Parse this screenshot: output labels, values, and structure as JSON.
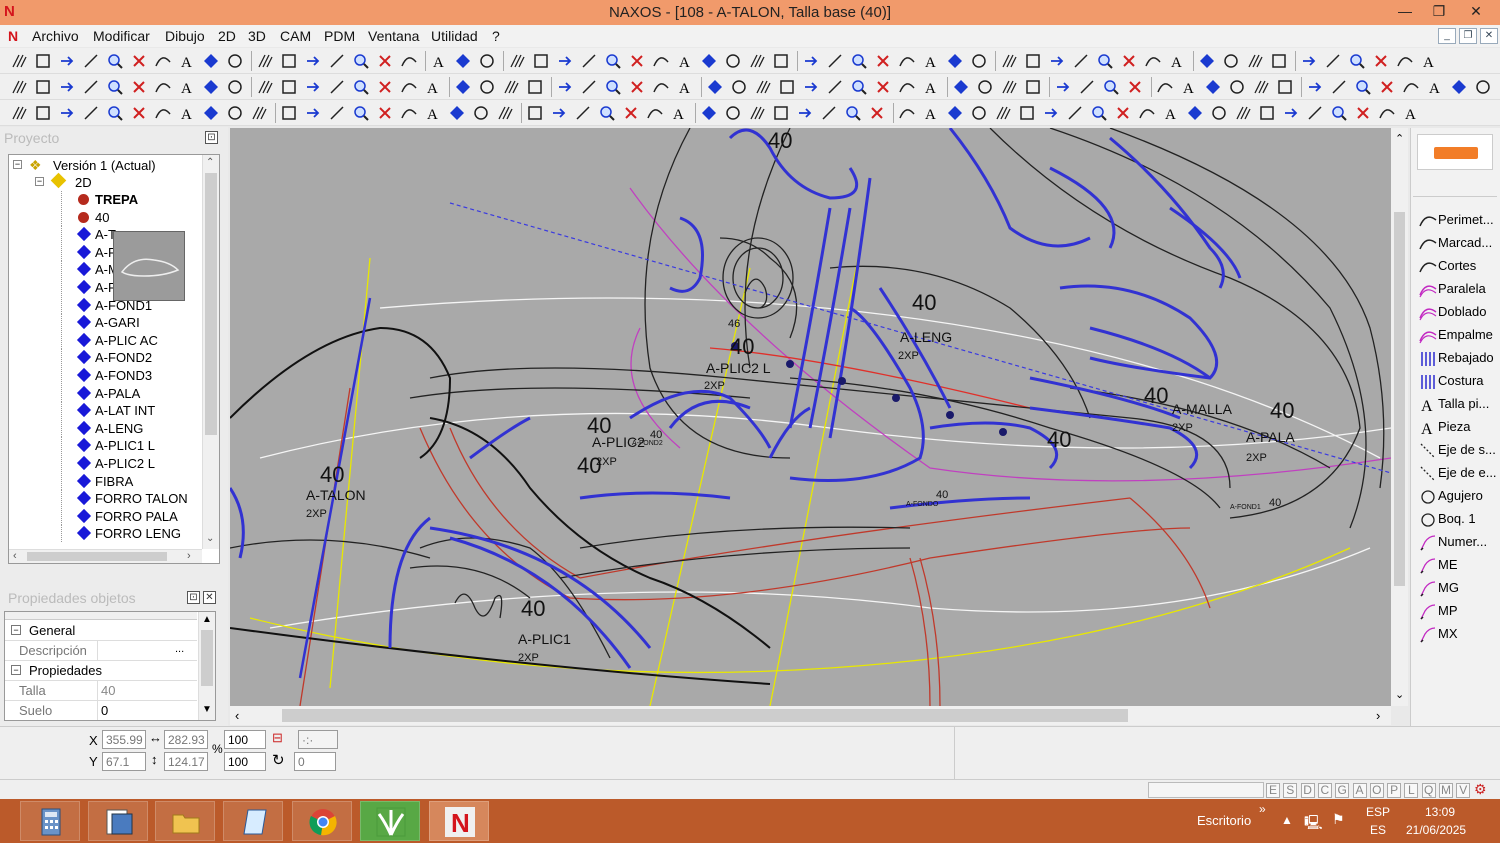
{
  "window": {
    "title": "NAXOS - [108 - A-TALON, Talla base (40)]",
    "minimize": "—",
    "maximize": "❐",
    "close": "✕"
  },
  "menu": [
    "Archivo",
    "Modificar",
    "Dibujo",
    "2D",
    "3D",
    "CAM",
    "PDM",
    "Ventana",
    "Utilidad",
    "?"
  ],
  "project_panel": {
    "title": "Proyecto",
    "root": "Versión 1 (Actual)",
    "folder": "2D",
    "items": [
      {
        "label": "TREPA",
        "type": "dot",
        "bold": true
      },
      {
        "label": "40",
        "type": "dot"
      },
      {
        "label": "A-T",
        "type": "dia"
      },
      {
        "label": "A-F",
        "type": "dia"
      },
      {
        "label": "A-M",
        "type": "dia"
      },
      {
        "label": "A-F",
        "type": "dia"
      },
      {
        "label": "A-FOND1",
        "type": "dia"
      },
      {
        "label": "A-GARI",
        "type": "dia"
      },
      {
        "label": "A-PLIC AC",
        "type": "dia"
      },
      {
        "label": "A-FOND2",
        "type": "dia"
      },
      {
        "label": "A-FOND3",
        "type": "dia"
      },
      {
        "label": "A-PALA",
        "type": "dia"
      },
      {
        "label": "A-LAT INT",
        "type": "dia"
      },
      {
        "label": "A-LENG",
        "type": "dia"
      },
      {
        "label": "A-PLIC1 L",
        "type": "dia"
      },
      {
        "label": "A-PLIC2 L",
        "type": "dia"
      },
      {
        "label": "FIBRA",
        "type": "dia"
      },
      {
        "label": "FORRO TALON",
        "type": "dia"
      },
      {
        "label": "FORRO PALA",
        "type": "dia"
      },
      {
        "label": "FORRO LENG",
        "type": "dia"
      }
    ]
  },
  "properties_panel": {
    "title": "Propiedades objetos",
    "general": "General",
    "descripcion_label": "Descripción",
    "descripcion_btn": "...",
    "propiedades": "Propiedades",
    "talla_label": "Talla",
    "talla_value": "40",
    "suelo_label": "Suelo",
    "suelo_value": "0"
  },
  "right_panel": {
    "items": [
      {
        "label": "Perimet...",
        "icon": "curve-icon"
      },
      {
        "label": "Marcad...",
        "icon": "curve-icon"
      },
      {
        "label": "Cortes",
        "icon": "curve-icon"
      },
      {
        "label": "Paralela",
        "icon": "double-curve-icon"
      },
      {
        "label": "Doblado",
        "icon": "double-curve-icon"
      },
      {
        "label": "Empalme",
        "icon": "double-curve-icon"
      },
      {
        "label": "Rebajado",
        "icon": "hatch-icon"
      },
      {
        "label": "Costura",
        "icon": "hatch-icon"
      },
      {
        "label": "Talla pi...",
        "icon": "text-a-icon"
      },
      {
        "label": "Pieza",
        "icon": "text-a-icon"
      },
      {
        "label": "Eje de s...",
        "icon": "diagonal-icon"
      },
      {
        "label": "Eje de e...",
        "icon": "diagonal-icon"
      },
      {
        "label": "Agujero",
        "icon": "circle-icon"
      },
      {
        "label": "Boq. 1",
        "icon": "circle-icon"
      },
      {
        "label": "Numer...",
        "icon": "pen-icon"
      },
      {
        "label": "ME",
        "icon": "pen-icon"
      },
      {
        "label": "MG",
        "icon": "pen-icon"
      },
      {
        "label": "MP",
        "icon": "pen-icon"
      },
      {
        "label": "MX",
        "icon": "pen-icon"
      }
    ]
  },
  "coords": {
    "x_label": "X",
    "x_value": "355.99",
    "y_label": "Y",
    "y_value": "67.1",
    "w_value": "282.93",
    "h_value": "124.17",
    "pct_x": "100",
    "pct_y": "100",
    "rot_value": "0",
    "pct_sign": "%"
  },
  "status_keys": [
    "E",
    "S",
    "D",
    "C",
    "G",
    "A",
    "O",
    "P",
    "L",
    "Q",
    "M",
    "V"
  ],
  "canvas_labels": [
    {
      "text": "40",
      "big": true
    },
    {
      "text": "40",
      "big": true
    },
    {
      "text": "A-LENG"
    },
    {
      "text": "2XP"
    },
    {
      "text": "40",
      "big": true
    },
    {
      "text": "A-PLIC2 L"
    },
    {
      "text": "2XP"
    },
    {
      "text": "46"
    },
    {
      "text": "40",
      "big": true
    },
    {
      "text": "A-MALLA"
    },
    {
      "text": "2XP"
    },
    {
      "text": "40",
      "big": true
    },
    {
      "text": "A-PALA"
    },
    {
      "text": "2XP"
    },
    {
      "text": "40",
      "big": true
    },
    {
      "text": "40",
      "big": true
    },
    {
      "text": "A-PLIC2"
    },
    {
      "text": "40",
      "big": true
    },
    {
      "text": "2XP"
    },
    {
      "text": "40",
      "big": true
    },
    {
      "text": "A-TALON"
    },
    {
      "text": "2XP"
    },
    {
      "text": "40",
      "big": true
    },
    {
      "text": "A-PLIC1"
    },
    {
      "text": "2XP"
    },
    {
      "text": "40"
    },
    {
      "text": "A-FOND2"
    },
    {
      "text": "40"
    },
    {
      "text": "A-FONDO"
    },
    {
      "text": "40"
    },
    {
      "text": "A-FOND1"
    }
  ],
  "taskbar": {
    "desktop_label": "Escritorio",
    "chevron": "»",
    "lang": "ESP",
    "lang2": "ES",
    "time": "13:09",
    "date": "21/06/2025",
    "apps": [
      "calculator-icon",
      "documents-icon",
      "file-explorer-icon",
      "notes-icon",
      "chrome-icon",
      "plant-icon",
      "naxos-icon"
    ]
  }
}
